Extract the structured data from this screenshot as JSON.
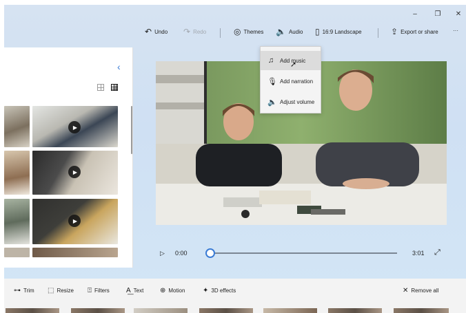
{
  "window_controls": {
    "minimize": "–",
    "maximize": "❐",
    "close": "✕"
  },
  "toolbar": {
    "undo": "Undo",
    "redo": "Redo",
    "themes": "Themes",
    "audio": "Audio",
    "aspect": "16:9 Landscape",
    "export": "Export or share",
    "more": "···"
  },
  "audio_menu": {
    "items": [
      {
        "label": "Add music",
        "icon": "music-note-icon"
      },
      {
        "label": "Add narration",
        "icon": "microphone-icon"
      },
      {
        "label": "Adjust volume",
        "icon": "speaker-icon"
      }
    ]
  },
  "library": {
    "back_icon": "chevron-left-icon",
    "view_modes": [
      "small-grid-icon",
      "large-grid-icon"
    ],
    "thumbnails_with_video_badge": 3
  },
  "player": {
    "current_time": "0:00",
    "total_time": "3:01",
    "progress": 0.0
  },
  "edit_tools": {
    "trim": "Trim",
    "resize": "Resize",
    "filters": "Filters",
    "text": "Text",
    "motion": "Motion",
    "effects": "3D effects",
    "remove_all": "Remove all"
  },
  "colors": {
    "accent": "#3a7bd5",
    "background": "#d6e3f2",
    "menu_bg": "#f4f4f4",
    "menu_hover": "#dcdcdc"
  }
}
